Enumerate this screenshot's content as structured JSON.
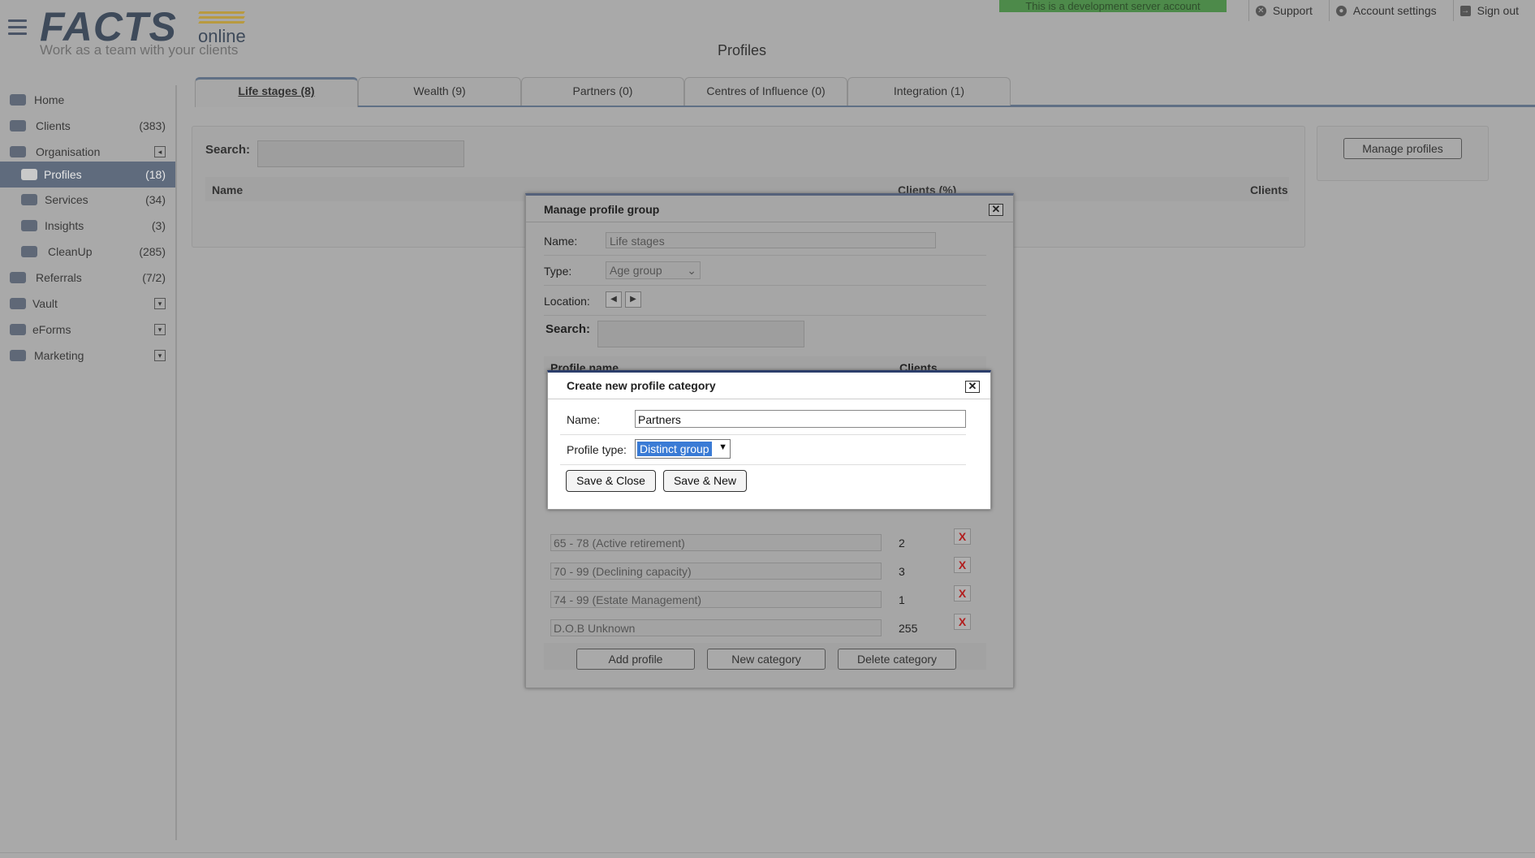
{
  "header": {
    "logo_main": "FACTS",
    "logo_suffix": "online",
    "logo_tagline": "Work as a team with your clients",
    "dev_banner": "This is a development server account",
    "links": [
      {
        "label": "Support",
        "icon": "support-icon"
      },
      {
        "label": "Account settings",
        "icon": "user-circle-icon"
      },
      {
        "label": "Sign out",
        "icon": "sign-out-icon"
      }
    ],
    "page_title": "Profiles"
  },
  "sidebar": {
    "items": [
      {
        "label": "Home",
        "count": "",
        "icon": "home-icon"
      },
      {
        "label": "Clients",
        "count": "(383)",
        "icon": "clients-icon"
      },
      {
        "label": "Organisation",
        "count": "",
        "icon": "organisation-icon",
        "toggle": "◂"
      },
      {
        "label": "Profiles",
        "count": "(18)",
        "icon": "tag-icon",
        "active": true
      },
      {
        "label": "Services",
        "count": "(34)",
        "icon": "services-chart-icon"
      },
      {
        "label": "Insights",
        "count": "(3)",
        "icon": "insights-icon"
      },
      {
        "label": "CleanUp",
        "count": "(285)",
        "icon": "cleanup-icon"
      },
      {
        "label": "Referrals",
        "count": "(7/2)",
        "icon": "referrals-icon"
      },
      {
        "label": "Vault",
        "count": "",
        "icon": "vault-icon",
        "toggle": "▾"
      },
      {
        "label": "eForms",
        "count": "",
        "icon": "list-icon",
        "toggle": "▾"
      },
      {
        "label": "Marketing",
        "count": "",
        "icon": "megaphone-icon",
        "toggle": "▾"
      }
    ]
  },
  "tabs": [
    {
      "label": "Life stages (8)",
      "active": true
    },
    {
      "label": "Wealth (9)"
    },
    {
      "label": "Partners (0)"
    },
    {
      "label": "Centres of Influence (0)"
    },
    {
      "label": "Integration (1)"
    }
  ],
  "main": {
    "search_label": "Search:",
    "columns": [
      "Name",
      "Clients (%)",
      "Clients"
    ],
    "manage_profiles_button": "Manage profiles"
  },
  "manage_dialog": {
    "title": "Manage profile group",
    "close": "✕",
    "name_label": "Name:",
    "name_value": "Life stages",
    "type_label": "Type:",
    "type_value": "Age group",
    "location_label": "Location:",
    "search_label": "Search:",
    "columns": [
      "Profile name",
      "Clients"
    ],
    "profiles": [
      {
        "name": "65 - 78 (Active retirement)",
        "clients": "2"
      },
      {
        "name": "70 - 99 (Declining capacity)",
        "clients": "3"
      },
      {
        "name": "74 - 99 (Estate Management)",
        "clients": "1"
      },
      {
        "name": "D.O.B Unknown",
        "clients": "255"
      }
    ],
    "delete_glyph": "X",
    "buttons": {
      "add": "Add profile",
      "new": "New category",
      "delete": "Delete category"
    }
  },
  "create_dialog": {
    "title": "Create new profile category",
    "close": "✕",
    "name_label": "Name:",
    "name_value": "Partners",
    "type_label": "Profile type:",
    "type_value": "Distinct group",
    "buttons": {
      "save_close": "Save & Close",
      "save_new": "Save & New"
    }
  },
  "colors": {
    "overlay_bg": "#a9a9a9",
    "active_nav": "#5f6b7d",
    "dialog_accent": "#2c3e6b",
    "select_highlight": "#3a7bd5",
    "delete_red": "#b21e1e"
  }
}
